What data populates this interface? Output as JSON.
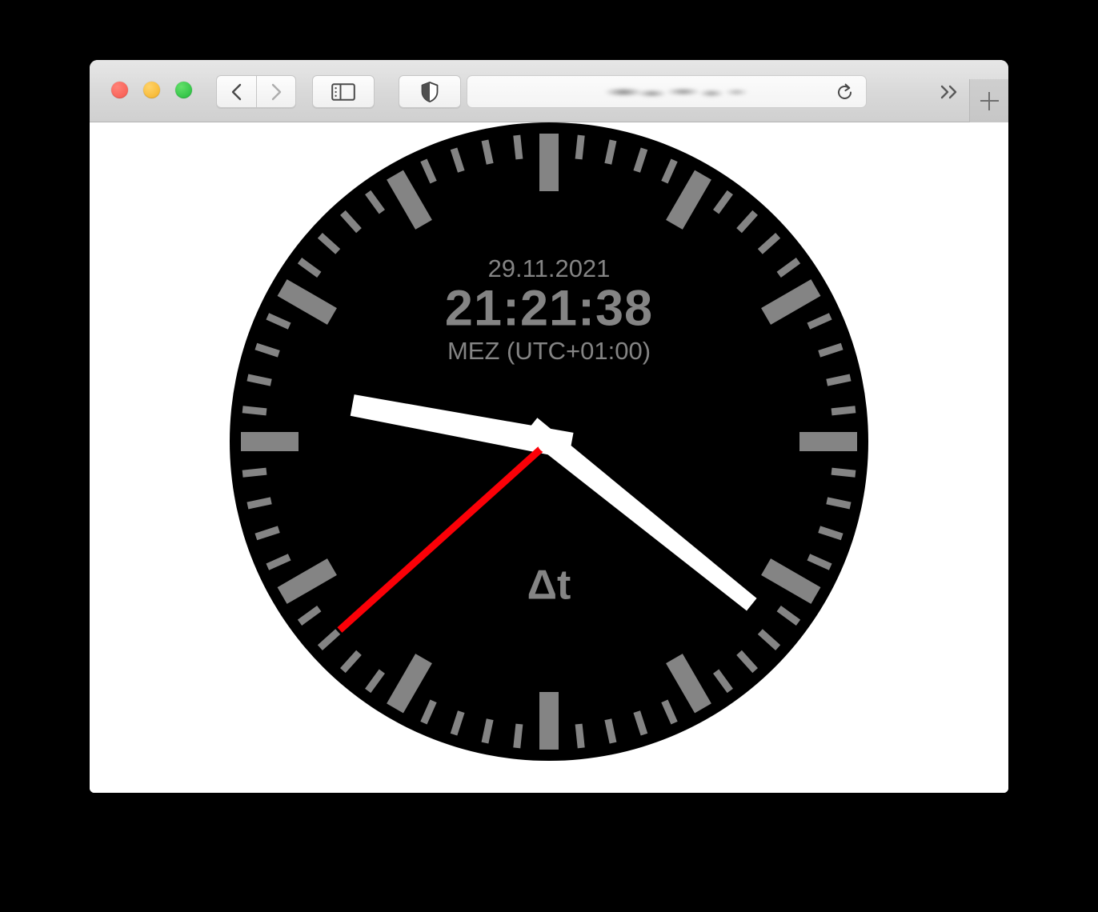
{
  "window": {
    "traffic_lights": [
      {
        "name": "close",
        "color": "#f6574d"
      },
      {
        "name": "minimize",
        "color": "#f4b024"
      },
      {
        "name": "maximize",
        "color": "#21b83a"
      }
    ],
    "toolbar": {
      "back_icon": "chevron-left-icon",
      "forward_icon": "chevron-right-icon",
      "sidebar_icon": "sidebar-toggle-icon",
      "shield_icon": "privacy-shield-icon",
      "reload_icon": "reload-icon",
      "overflow_icon": "overflow-chevrons-icon",
      "new_tab_icon": "plus-icon",
      "address_value": "",
      "address_placeholder": "",
      "address_state": "blurred"
    }
  },
  "clock": {
    "date": "29.11.2021",
    "time": "21:21:38",
    "timezone": "MEZ (UTC+01:00)",
    "delta_label": "Δt",
    "face_color": "#000000",
    "tick_color": "#848484",
    "hand_color": "#ffffff",
    "second_hand_color": "#fb0007",
    "text_color": "#848484",
    "hours": 21,
    "minutes": 21,
    "seconds": 38,
    "hour_angle_deg": 280.5,
    "minute_angle_deg": 128.8,
    "second_angle_deg": 228,
    "hour_ticks": 12,
    "minute_ticks": 60
  }
}
